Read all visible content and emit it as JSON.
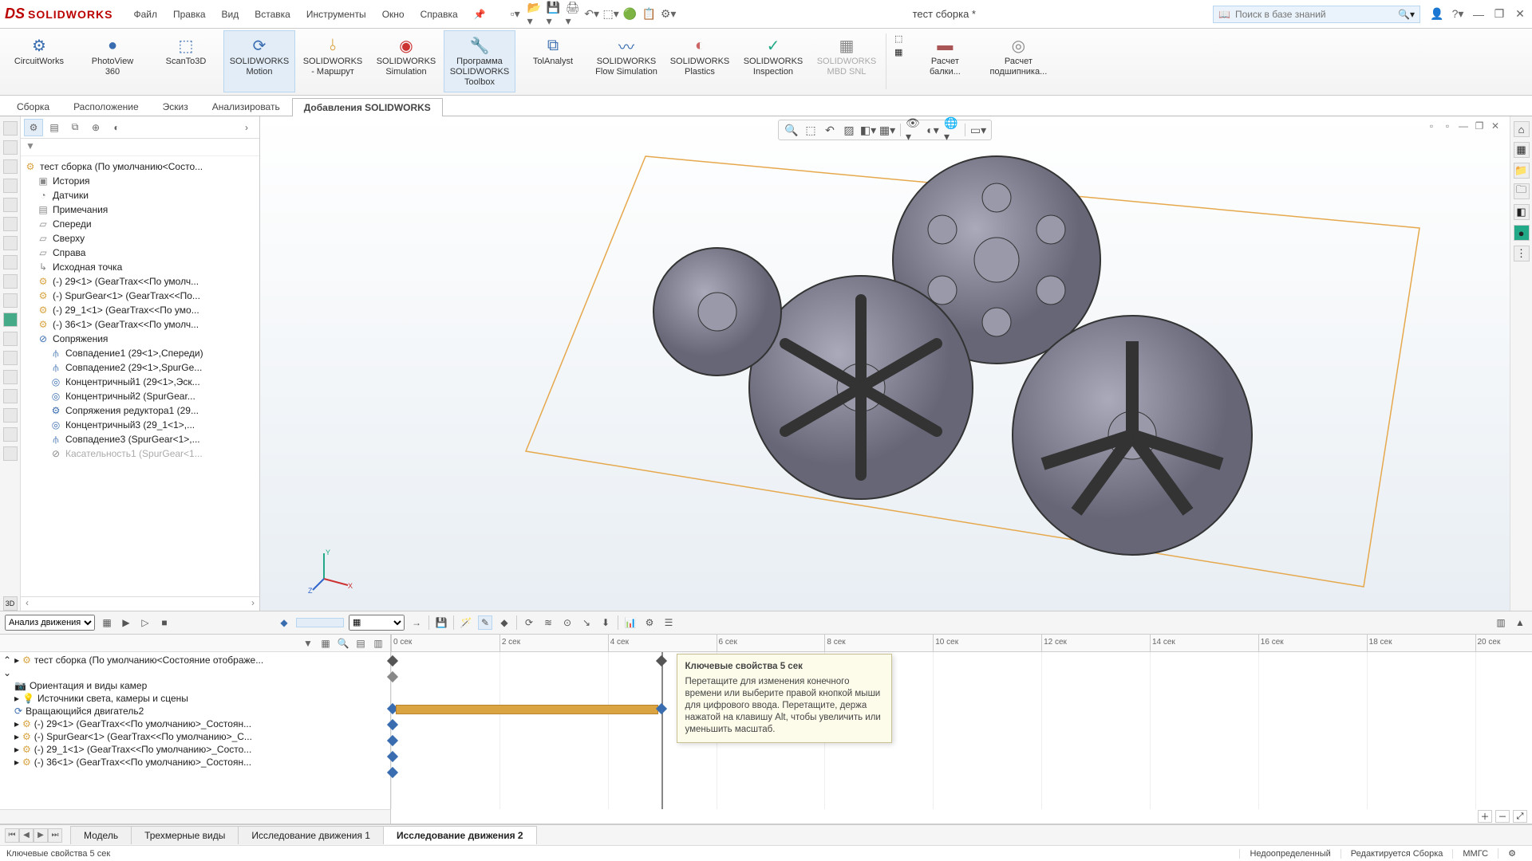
{
  "app": {
    "title": "тест сборка *",
    "logo_ds": "DS",
    "logo_sw": "SOLIDWORKS"
  },
  "menu": {
    "file": "Файл",
    "edit": "Правка",
    "view": "Вид",
    "insert": "Вставка",
    "tools": "Инструменты",
    "window": "Окно",
    "help": "Справка"
  },
  "search": {
    "placeholder": "Поиск в базе знаний"
  },
  "ribbon": {
    "circuitworks": "CircuitWorks",
    "photoview": "PhotoView\n360",
    "scanto3d": "ScanTo3D",
    "motion": "SOLIDWORKS\nMotion",
    "routing": "SOLIDWORKS\n- Маршрут",
    "simulation": "SOLIDWORKS\nSimulation",
    "toolbox": "Программа\nSOLIDWORKS Toolbox",
    "tolanalyst": "TolAnalyst",
    "flow": "SOLIDWORKS\nFlow Simulation",
    "plastics": "SOLIDWORKS\nPlastics",
    "inspection": "SOLIDWORKS\nInspection",
    "mbd": "SOLIDWORKS\nMBD SNL",
    "beam": "Расчет\nбалки...",
    "bearing": "Расчет\nподшипника..."
  },
  "tabs": {
    "assembly": "Сборка",
    "layout": "Расположение",
    "sketch": "Эскиз",
    "analyze": "Анализировать",
    "addins": "Добавления SOLIDWORKS"
  },
  "tree": {
    "root": "тест сборка  (По умолчанию<Состо...",
    "history": "История",
    "sensors": "Датчики",
    "annotations": "Примечания",
    "front": "Спереди",
    "top": "Сверху",
    "right": "Справа",
    "origin": "Исходная точка",
    "p1": "(-) 29<1> (GearTrax<<По умолч...",
    "p2": "(-) SpurGear<1> (GearTrax<<По...",
    "p3": "(-) 29_1<1> (GearTrax<<По умо...",
    "p4": "(-) 36<1> (GearTrax<<По умолч...",
    "mates": "Сопряжения",
    "m1": "Совпадение1 (29<1>,Спереди)",
    "m2": "Совпадение2 (29<1>,SpurGe...",
    "m3": "Концентричный1 (29<1>,Эск...",
    "m4": "Концентричный2 (SpurGear...",
    "m5": "Сопряжения редуктора1 (29...",
    "m6": "Концентричный3 (29_1<1>,...",
    "m7": "Совпадение3 (SpurGear<1>,...",
    "m8": "Касательность1 (SpurGear<1..."
  },
  "motion": {
    "study_type": "Анализ движения",
    "root": "тест сборка  (По умолчанию<Состояние отображе...",
    "cam": "Ориентация и виды камер",
    "lights": "Источники света, камеры и сцены",
    "motor": "Вращающийся двигатель2",
    "c1": "(-) 29<1> (GearTrax<<По умолчанию>_Состоян...",
    "c2": "(-) SpurGear<1> (GearTrax<<По умолчанию>_С...",
    "c3": "(-) 29_1<1> (GearTrax<<По умолчанию>_Состо...",
    "c4": "(-) 36<1> (GearTrax<<По умолчанию>_Состоян..."
  },
  "timeline": {
    "ticks": [
      "0 сек",
      "2 сек",
      "4 сек",
      "6 сек",
      "8 сек",
      "10 сек",
      "12 сек",
      "14 сек",
      "16 сек",
      "18 сек",
      "20 сек"
    ],
    "tooltip_title": "Ключевые свойства 5 сек",
    "tooltip_body": "Перетащите для изменения конечного времени или выберите правой кнопкой мыши для цифрового ввода. Перетащите, держа нажатой на клавишу Alt, чтобы увеличить или уменьшить масштаб."
  },
  "btabs": {
    "model": "Модель",
    "3dview": "Трехмерные виды",
    "study1": "Исследование движения 1",
    "study2": "Исследование движения 2"
  },
  "status": {
    "hint": "Ключевые свойства 5 сек",
    "underdef": "Недоопределенный",
    "editing": "Редактируется Сборка",
    "units": "ММГС"
  }
}
